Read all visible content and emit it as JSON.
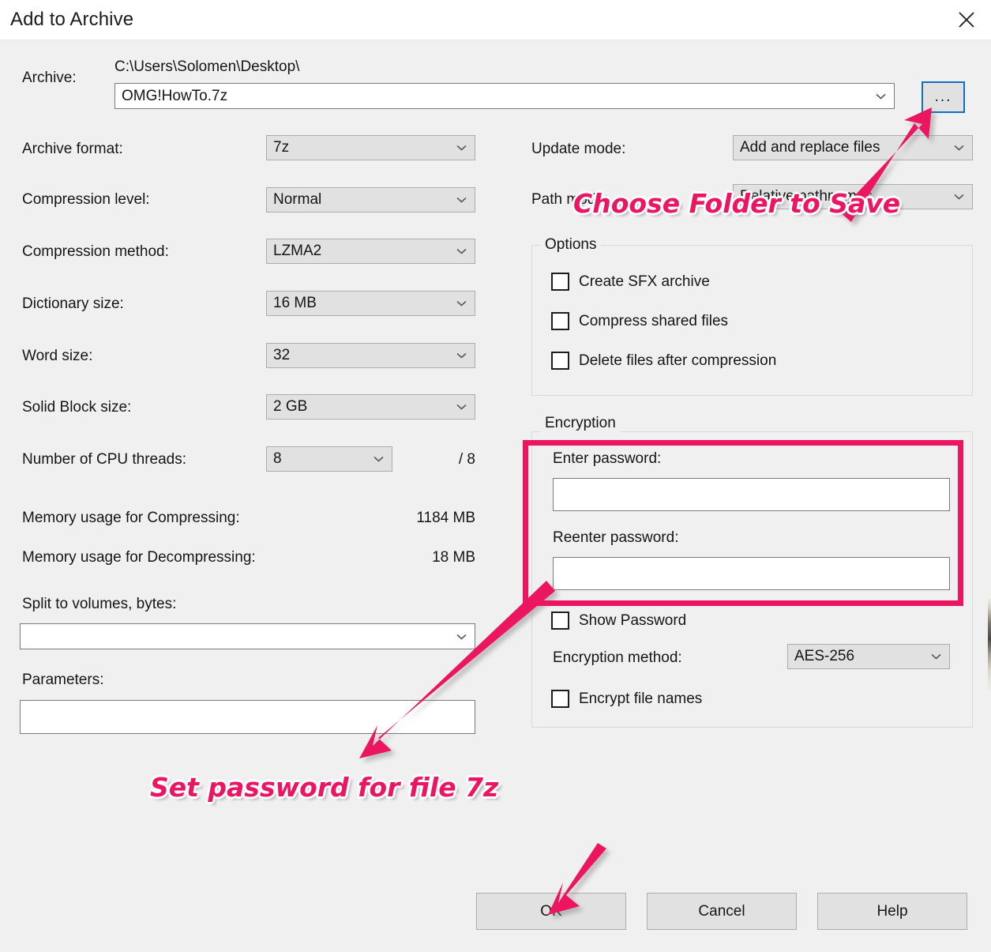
{
  "window": {
    "title": "Add to Archive",
    "close_icon": "close-icon"
  },
  "archive": {
    "label": "Archive:",
    "path": "C:\\Users\\Solomen\\Desktop\\",
    "filename": "OMG!HowTo.7z",
    "browse_label": "...",
    "dropdown_icon": "chevron-down-icon"
  },
  "left_fields": [
    {
      "label": "Archive format:",
      "value": "7z",
      "type": "combo"
    },
    {
      "label": "Compression level:",
      "value": "Normal",
      "type": "combo"
    },
    {
      "label": "Compression method:",
      "value": "LZMA2",
      "type": "combo"
    },
    {
      "label": "Dictionary size:",
      "value": "16 MB",
      "type": "combo"
    },
    {
      "label": "Word size:",
      "value": "32",
      "type": "combo"
    },
    {
      "label": "Solid Block size:",
      "value": "2 GB",
      "type": "combo"
    }
  ],
  "cpu_threads": {
    "label": "Number of CPU threads:",
    "value": "8",
    "max_text": "/ 8"
  },
  "memory": [
    {
      "label": "Memory usage for Compressing:",
      "value": "1184 MB"
    },
    {
      "label": "Memory usage for Decompressing:",
      "value": "18 MB"
    }
  ],
  "split": {
    "label": "Split to volumes, bytes:",
    "value": ""
  },
  "parameters": {
    "label": "Parameters:",
    "value": ""
  },
  "update_mode": {
    "label": "Update mode:",
    "value": "Add and replace files"
  },
  "path_mode": {
    "label": "Path mode:",
    "value": "Relative pathnames"
  },
  "options": {
    "title": "Options",
    "items": [
      {
        "label": "Create SFX archive",
        "checked": false
      },
      {
        "label": "Compress shared files",
        "checked": false
      },
      {
        "label": "Delete files after compression",
        "checked": false
      }
    ]
  },
  "encryption": {
    "title": "Encryption",
    "enter_password_label": "Enter password:",
    "enter_password_value": "",
    "reenter_password_label": "Reenter password:",
    "reenter_password_value": "",
    "show_password_label": "Show Password",
    "show_password_checked": false,
    "method_label": "Encryption method:",
    "method_value": "AES-256",
    "encrypt_names_label": "Encrypt file names",
    "encrypt_names_checked": false
  },
  "buttons": {
    "ok": "OK",
    "cancel": "Cancel",
    "help": "Help"
  },
  "annotations": {
    "accent_color": "#ec1561",
    "choose_folder": "Choose Folder to Save",
    "set_password": "Set password for file 7z",
    "arrows": [
      {
        "name": "arrow-to-browse-button"
      },
      {
        "name": "arrow-to-password-fields"
      },
      {
        "name": "arrow-to-ok-button"
      }
    ],
    "highlight_rect": "encryption-password-highlight"
  }
}
